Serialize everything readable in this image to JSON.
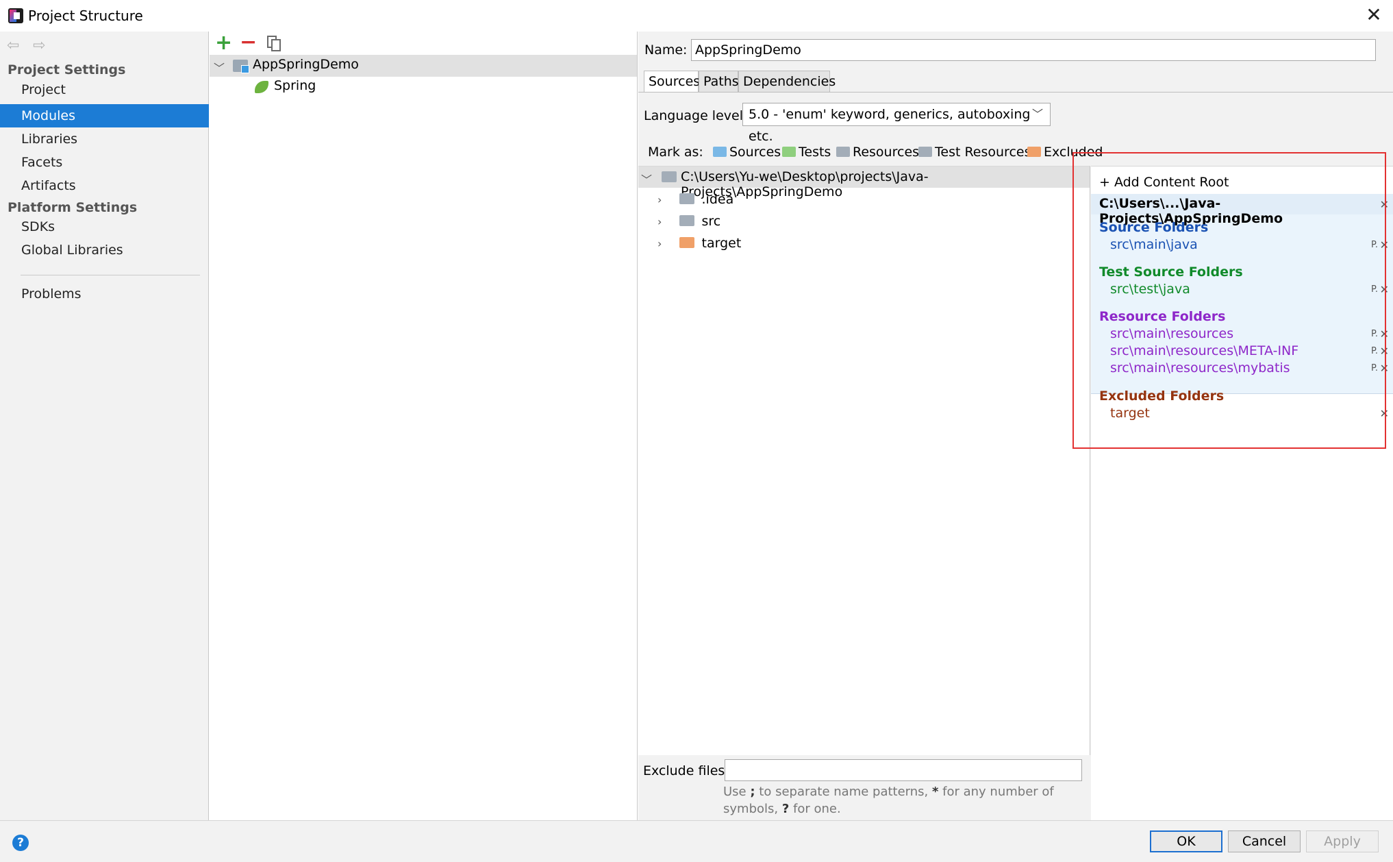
{
  "window": {
    "title": "Project Structure",
    "close": "✕"
  },
  "nav": {
    "back": "⇦",
    "forward": "⇨"
  },
  "sidebar": {
    "project_settings_title": "Project Settings",
    "project_items": [
      "Project",
      "Modules",
      "Libraries",
      "Facets",
      "Artifacts"
    ],
    "selected": "Modules",
    "platform_settings_title": "Platform Settings",
    "platform_items": [
      "SDKs",
      "Global Libraries"
    ],
    "problems": "Problems"
  },
  "modules": {
    "add": "+",
    "remove": "−",
    "root": "AppSpringDemo",
    "child": "Spring"
  },
  "module_settings": {
    "name_label": "Name:",
    "name_value": "AppSpringDemo",
    "tabs": [
      "Sources",
      "Paths",
      "Dependencies"
    ],
    "active_tab": "Sources",
    "language_level_label": "Language level:",
    "language_level_value": "5.0 - 'enum' keyword, generics, autoboxing etc.",
    "mark_as_label": "Mark as:",
    "mark_as": [
      {
        "label": "Sources",
        "color": "#7ab8e6"
      },
      {
        "label": "Tests",
        "color": "#8fcf7e"
      },
      {
        "label": "Resources",
        "color": "#a3adb8"
      },
      {
        "label": "Test Resources",
        "color": "#a3adb8"
      },
      {
        "label": "Excluded",
        "color": "#f0a068"
      }
    ],
    "tree": {
      "root_path": "C:\\Users\\Yu-we\\Desktop\\projects\\Java-Projects\\AppSpringDemo",
      "children": [
        {
          "name": ".idea",
          "color": "#a3adb8"
        },
        {
          "name": "src",
          "color": "#a3adb8"
        },
        {
          "name": "target",
          "color": "#f0a068"
        }
      ]
    },
    "exclude_files_label": "Exclude files:",
    "exclude_files_value": "",
    "exclude_hint_a": "Use ",
    "exclude_hint_b": ";",
    "exclude_hint_c": " to separate name patterns, ",
    "exclude_hint_d": "*",
    "exclude_hint_e": " for any number of symbols, ",
    "exclude_hint_f": "?",
    "exclude_hint_g": " for one."
  },
  "content_root": {
    "add_label": "+ Add Content Root",
    "path": "C:\\Users\\...\\Java-Projects\\AppSpringDemo",
    "sections": [
      {
        "title": "Source Folders",
        "color": "#1a52b3",
        "entry_color": "#1a52b3",
        "entries": [
          "src\\main\\java"
        ]
      },
      {
        "title": "Test Source Folders",
        "color": "#108a2a",
        "entry_color": "#108a2a",
        "entries": [
          "src\\test\\java"
        ]
      },
      {
        "title": "Resource Folders",
        "color": "#8e27c9",
        "entry_color": "#8e27c9",
        "entries": [
          "src\\main\\resources",
          "src\\main\\resources\\META-INF",
          "src\\main\\resources\\mybatis"
        ]
      },
      {
        "title": "Excluded Folders",
        "color": "#953410",
        "entry_color": "#953410",
        "entries": [
          "target"
        ]
      }
    ],
    "remove_icon": "✕",
    "props_icon": "P."
  },
  "buttons": {
    "help": "?",
    "ok": "OK",
    "cancel": "Cancel",
    "apply": "Apply"
  },
  "colors": {
    "selection": "#1c7cd5",
    "highlight": "#e33131"
  }
}
